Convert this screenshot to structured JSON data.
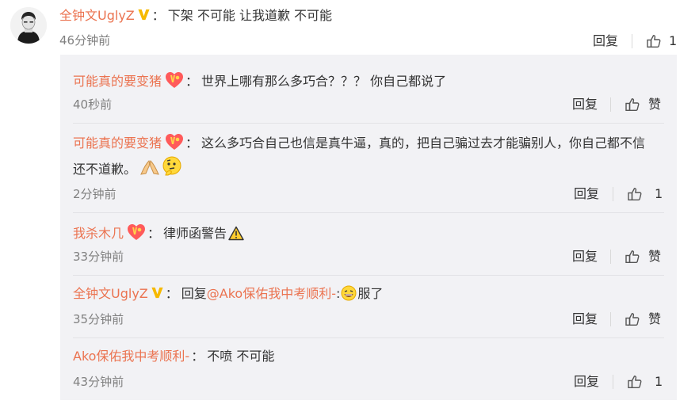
{
  "main_comment": {
    "author": "全钟文UglyZ",
    "verified_icon": "verified-v-badge-icon",
    "separator": "：",
    "text": "下架 不可能  让我道歉 不可能",
    "time": "46分钟前",
    "reply_label": "回复",
    "like_count": "1"
  },
  "replies": [
    {
      "author": "可能真的要变猪",
      "badge_icon": "vip-heart-badge-icon",
      "separator": "：",
      "text": "世界上哪有那么多巧合？？？ 你自己都说了",
      "time": "40秒前",
      "reply_label": "回复",
      "like_label": "赞"
    },
    {
      "author": "可能真的要变猪",
      "badge_icon": "vip-heart-badge-icon",
      "separator": "：",
      "text": "这么多巧合自己也信是真牛逼，真的，把自己骗过去才能骗别人，你自己都不信还不道歉。",
      "emojis": [
        "pray-hands-emoji-icon",
        "thinking-face-emoji-icon"
      ],
      "time": "2分钟前",
      "reply_label": "回复",
      "like_label": "1"
    },
    {
      "author": "我杀木几",
      "badge_icon": "vip-heart-badge-icon",
      "separator": "：",
      "text": "律师函警告",
      "emojis": [
        "warning-sign-emoji-icon"
      ],
      "time": "33分钟前",
      "reply_label": "回复",
      "like_label": "赞"
    },
    {
      "author": "全钟文UglyZ",
      "badge_icon": "verified-v-badge-icon",
      "separator": "：",
      "reply_prefix": "回复",
      "mention": "@Ako保佑我中考顺利-",
      "mention_sep": ":",
      "text": "服了",
      "emojis": [
        "laughing-face-emoji-icon"
      ],
      "time": "35分钟前",
      "reply_label": "回复",
      "like_label": "赞"
    },
    {
      "author": "Ako保佑我中考顺利-",
      "separator": "：",
      "text": "不喷 不可能",
      "time": "43分钟前",
      "reply_label": "回复",
      "like_label": "1"
    }
  ],
  "colors": {
    "name": "#eb7350",
    "time": "#808080",
    "reply_panel_bg": "#f2f2f5",
    "verified_badge": "#f6b900"
  }
}
